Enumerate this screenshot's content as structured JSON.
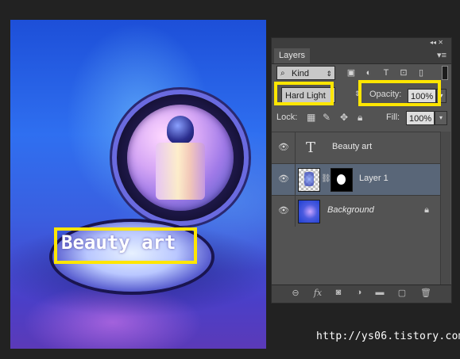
{
  "canvas": {
    "text_layer_content": "Beauty art"
  },
  "layers_panel": {
    "tab_label": "Layers",
    "filter": {
      "kind_label": "Kind",
      "icons": [
        "image-filter-icon",
        "adjustment-filter-icon",
        "type-filter-icon",
        "shape-filter-icon",
        "smart-object-filter-icon"
      ]
    },
    "blend_mode": "Hard Light",
    "opacity_label": "Opacity:",
    "opacity_value": "100%",
    "lock_label": "Lock:",
    "fill_label": "Fill:",
    "fill_value": "100%",
    "layers": [
      {
        "name": "Beauty art",
        "type": "text",
        "selected": false
      },
      {
        "name": "Layer 1",
        "type": "image-with-mask",
        "selected": true
      },
      {
        "name": "Background",
        "type": "background",
        "locked": true,
        "selected": false
      }
    ],
    "highlight_color": "#ffe600",
    "selected_row_color": "#596678"
  },
  "watermark": "http://ys06.tistory.com"
}
